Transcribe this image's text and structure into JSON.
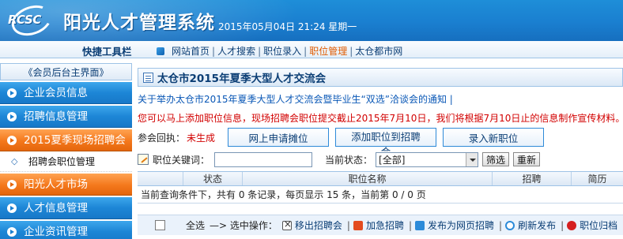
{
  "header": {
    "logo_text": "RCSC",
    "title": "阳光人才管理系统",
    "datetime": "2015年05月04日 21:24 星期一"
  },
  "toolbar": {
    "quick_label": "快捷工具栏",
    "nav": [
      {
        "label": "网站首页",
        "active": false
      },
      {
        "label": "人才搜索",
        "active": false
      },
      {
        "label": "职位录入",
        "active": false
      },
      {
        "label": "职位管理",
        "active": true
      },
      {
        "label": "太仓都市网",
        "active": false
      }
    ],
    "separator": "|"
  },
  "sidebar": {
    "home_label": "《会员后台主界面》",
    "items": [
      {
        "label": "企业会员信息",
        "style": "blue"
      },
      {
        "label": "招聘信息管理",
        "style": "blue"
      },
      {
        "label": "2015夏季现场招聘会",
        "style": "orange"
      },
      {
        "label": "招聘会职位管理",
        "style": "sub"
      },
      {
        "label": "阳光人才市场",
        "style": "orange"
      },
      {
        "label": "人才信息管理",
        "style": "blue"
      },
      {
        "label": "企业资讯管理",
        "style": "blue"
      }
    ]
  },
  "main": {
    "title": "太仓市2015年夏季大型人才交流会",
    "notice_link": "关于举办太仓市2015年夏季大型人才交流会暨毕业生“双选”洽谈会的通知 |",
    "notice_red": "您可以马上添加职位信息，现场招聘会职位提交截止2015年7月10日，我们将根据7月10日止的信息制作宣传材料。",
    "participation_label": "参会回执：",
    "participation_status": "未生成",
    "buttons": {
      "apply_booth": "网上申请摊位",
      "add_job_to_fair": "添加职位到招聘会",
      "enter_new_job": "录入新职位"
    },
    "filter": {
      "keyword_label": "职位关键词：",
      "keyword_value": "",
      "status_label": "当前状态：",
      "status_selected": "[全部]",
      "filter_button": "筛选",
      "reset_button": "重新"
    },
    "table": {
      "headers": [
        "",
        "状态",
        "职位名称",
        "招聘",
        "简历"
      ],
      "summary": "当前查询条件下，共有 0 条记录，每页显示 15 条，当前第 0 / 0 页"
    },
    "footer": {
      "select_all": "全选",
      "selected_ops_label": "—> 选中操作：",
      "ops": [
        {
          "label": "移出招聘会",
          "icon": "remove-icon"
        },
        {
          "label": "加急招聘",
          "icon": "urgent-icon"
        },
        {
          "label": "发布为网页招聘",
          "icon": "publish-icon"
        },
        {
          "label": "刷新发布",
          "icon": "refresh-icon"
        },
        {
          "label": "职位归档",
          "icon": "archive-icon"
        }
      ]
    }
  }
}
